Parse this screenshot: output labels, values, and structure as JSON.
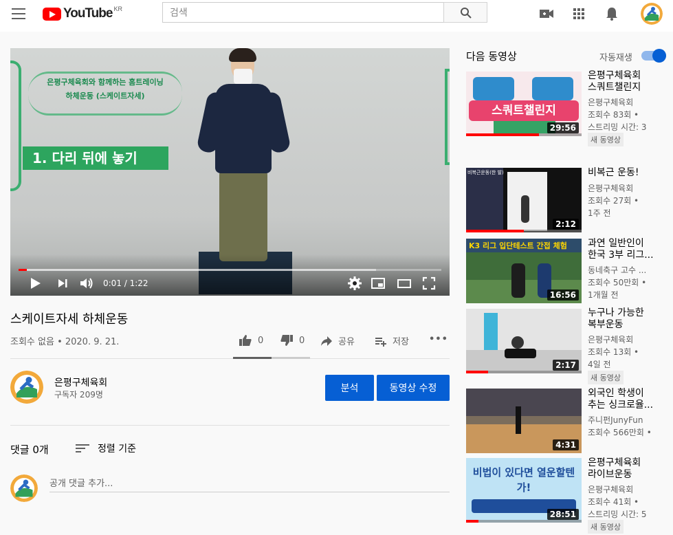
{
  "header": {
    "logo_text": "YouTube",
    "logo_region": "KR",
    "search_placeholder": "검색"
  },
  "player": {
    "sign_line1": "은평구체육회와 함께하는 홈트레이닝",
    "sign_line2": "하체운동 (스케이트자세)",
    "overlay_caption": "1. 다리 뒤에 놓기",
    "time": "0:01 / 1:22",
    "progress": 0.02
  },
  "video": {
    "title": "스케이트자세 하체운동",
    "meta": "조회수 없음 • 2020. 9. 21.",
    "likes": "0",
    "dislikes": "0",
    "share_label": "공유",
    "save_label": "저장",
    "more_label": "•••"
  },
  "channel": {
    "name": "은평구체육회",
    "subscribers": "구독자 209명",
    "analytics_button": "분석",
    "edit_button": "동영상 수정"
  },
  "comments": {
    "count_label": "댓글 0개",
    "sort_label": "정렬 기준",
    "input_placeholder": "공개 댓글 추가..."
  },
  "sidebar": {
    "heading": "다음 동영상",
    "autoplay_label": "자동재생",
    "autoplay_on": true,
    "items": [
      {
        "title_line1": "은평구체육회",
        "title_line2": "스쿼트챌린지",
        "channel": "은평구체육회",
        "views": "조회수 83회 •",
        "extra": "스트리밍 시간: 3",
        "badge": "새 동영상",
        "duration": "29:56",
        "thumb_text": "스쿼트챌린지"
      },
      {
        "title_line1": "비복근 운동!",
        "title_line2": "",
        "channel": "은평구체육회",
        "views": "조회수 27회 •",
        "extra": "1주 전",
        "badge": "",
        "duration": "2:12",
        "thumb_text": "비복근운동(한 발)"
      },
      {
        "title_line1": "과연 일반인이",
        "title_line2": "한국 3부 리그...",
        "channel": "동네축구 고수 ...",
        "views": "조회수 50만회 •",
        "extra": "1개월 전",
        "badge": "",
        "duration": "16:56",
        "thumb_text": "K3 리그 입단테스트 간접 체험"
      },
      {
        "title_line1": "누구나 가능한",
        "title_line2": "복부운동",
        "channel": "은평구체육회",
        "views": "조회수 13회 •",
        "extra": "4일 전",
        "badge": "새 동영상",
        "duration": "2:17",
        "thumb_text": ""
      },
      {
        "title_line1": "외국인 학생이",
        "title_line2": "추는 싱크로율...",
        "channel": "주니펀JunyFun",
        "views": "조회수 566만회 •",
        "extra": "",
        "badge": "",
        "duration": "4:31",
        "thumb_text": ""
      },
      {
        "title_line1": "은평구체육회",
        "title_line2": "라이브운동",
        "channel": "은평구체육회",
        "views": "조회수 41회 •",
        "extra": "스트리밍 시간: 5",
        "badge": "새 동영상",
        "duration": "28:51",
        "thumb_text": "비법이 있다면 열운할텐가!"
      }
    ]
  },
  "colors": {
    "brand_red": "#ff0000",
    "accent_blue": "#065fd4",
    "sign_green": "#2da55e"
  }
}
